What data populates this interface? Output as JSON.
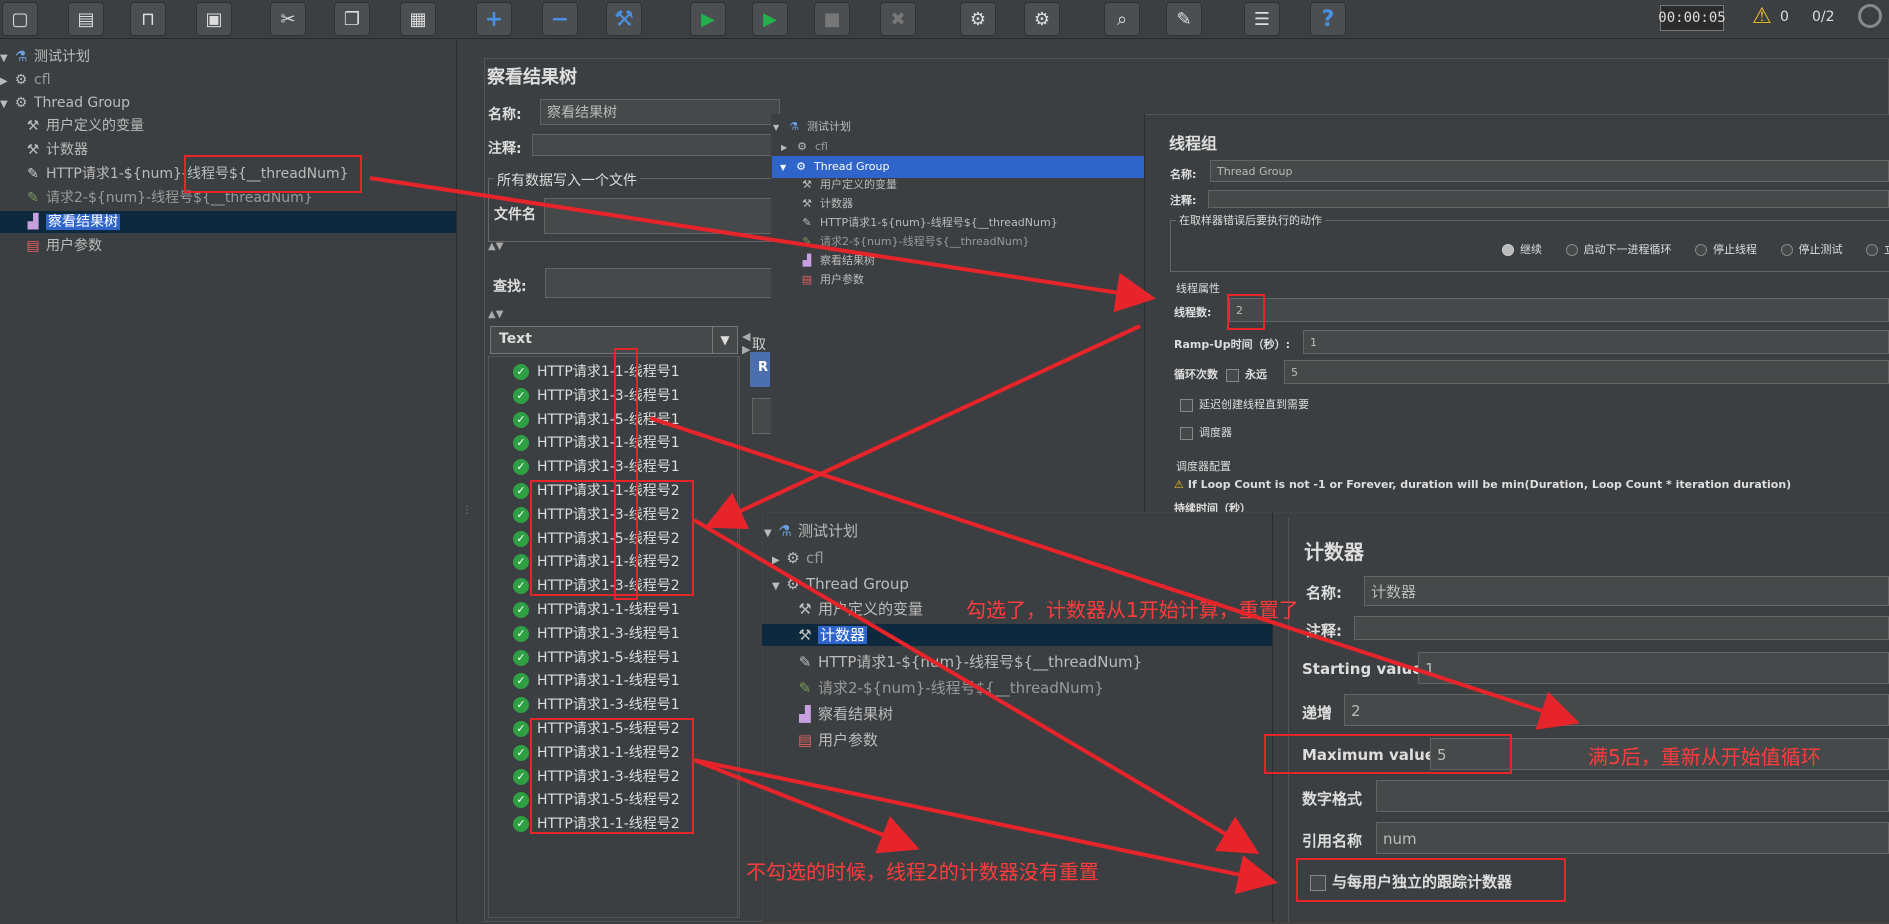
{
  "toolbar": {
    "buttons": [
      {
        "name": "new-icon",
        "glyph": "▢"
      },
      {
        "name": "templates-icon",
        "glyph": "▤"
      },
      {
        "name": "open-icon",
        "glyph": "⊓"
      },
      {
        "name": "save-icon",
        "glyph": "▣"
      },
      {
        "name": "cut-icon",
        "glyph": "✂"
      },
      {
        "name": "copy-icon",
        "glyph": "❐"
      },
      {
        "name": "paste-icon",
        "glyph": "▦"
      },
      {
        "name": "expand-icon",
        "glyph": "+"
      },
      {
        "name": "collapse-icon",
        "glyph": "−"
      },
      {
        "name": "toggle-icon",
        "glyph": "⚒"
      },
      {
        "name": "start-icon",
        "glyph": "▶"
      },
      {
        "name": "start-no-pause-icon",
        "glyph": "▶"
      },
      {
        "name": "stop-icon",
        "glyph": "■"
      },
      {
        "name": "shutdown-icon",
        "glyph": "✖"
      },
      {
        "name": "clear-icon",
        "glyph": "⚙"
      },
      {
        "name": "clear-all-icon",
        "glyph": "⚙"
      },
      {
        "name": "search-icon",
        "glyph": "⌕"
      },
      {
        "name": "reset-search-icon",
        "glyph": "✎"
      },
      {
        "name": "function-helper-icon",
        "glyph": "☰"
      },
      {
        "name": "help-icon",
        "glyph": "?"
      }
    ],
    "timer": "00:00:05",
    "warnings": "0",
    "threads": "0/2"
  },
  "left_tree": {
    "root": "测试计划",
    "cfl": "cfl",
    "thread_group": "Thread Group",
    "user_vars": "用户定义的变量",
    "counter": "计数器",
    "http1": "HTTP请求1-${num}-线程号${__threadNum}",
    "http1_prefix": "HTTP请求1-${num}-",
    "http1_suffix": "线程号${__threadNum}",
    "http2": "请求2-${num}-线程号${__threadNum}",
    "view_tree": "察看结果树",
    "user_params": "用户参数"
  },
  "main": {
    "title": "察看结果树",
    "name_label": "名称:",
    "name_value": "察看结果树",
    "comment_label": "注释:",
    "write_group": "所有数据写入一个文件",
    "filename_label": "文件名",
    "search_label": "查找:",
    "renderer": "Text",
    "tab_partial": "取",
    "results": [
      "HTTP请求1-1-线程号1",
      "HTTP请求1-3-线程号1",
      "HTTP请求1-5-线程号1",
      "HTTP请求1-1-线程号1",
      "HTTP请求1-3-线程号1",
      "HTTP请求1-1-线程号2",
      "HTTP请求1-3-线程号2",
      "HTTP请求1-5-线程号2",
      "HTTP请求1-1-线程号2",
      "HTTP请求1-3-线程号2",
      "HTTP请求1-1-线程号1",
      "HTTP请求1-3-线程号1",
      "HTTP请求1-5-线程号1",
      "HTTP请求1-1-线程号1",
      "HTTP请求1-3-线程号1",
      "HTTP请求1-5-线程号2",
      "HTTP请求1-1-线程号2",
      "HTTP请求1-3-线程号2",
      "HTTP请求1-5-线程号2",
      "HTTP请求1-1-线程号2"
    ]
  },
  "tg_window": {
    "tree": {
      "root": "测试计划",
      "cfl": "cfl",
      "thread_group": "Thread Group",
      "user_vars": "用户定义的变量",
      "counter": "计数器",
      "http1": "HTTP请求1-${num}-线程号${__threadNum}",
      "http2": "请求2-${num}-线程号${__threadNum}",
      "view_tree": "察看结果树",
      "user_params": "用户参数"
    },
    "title": "线程组",
    "name_label": "名称:",
    "name_value": "Thread Group",
    "comment_label": "注释:",
    "error_group": "在取样器错误后要执行的动作",
    "radios": [
      "继续",
      "启动下一进程循环",
      "停止线程",
      "停止测试",
      "立"
    ],
    "props_group": "线程属性",
    "threads_label": "线程数:",
    "threads_value": "2",
    "rampup_label": "Ramp-Up时间（秒）:",
    "rampup_value": "1",
    "loop_label": "循环次数",
    "forever_label": "永远",
    "loop_value": "5",
    "delay_label": "延迟创建线程直到需要",
    "scheduler_label": "调度器",
    "sched_group": "调度器配置",
    "sched_warning": "If Loop Count is not -1 or Forever, duration will be min(Duration, Loop Count * iteration duration)",
    "duration_partial": "持续时间（秒）"
  },
  "counter_window": {
    "tree": {
      "root": "测试计划",
      "cfl": "cfl",
      "thread_group": "Thread Group",
      "user_vars": "用户定义的变量",
      "counter": "计数器",
      "http1": "HTTP请求1-${num}-线程号${__threadNum}",
      "http2": "请求2-${num}-线程号${__threadNum}",
      "view_tree": "察看结果树",
      "user_params": "用户参数"
    },
    "title": "计数器",
    "name_label": "名称:",
    "name_value": "计数器",
    "comment_label": "注释:",
    "start_label": "Starting value",
    "start_value": "1",
    "incr_label": "递增",
    "incr_value": "2",
    "max_label": "Maximum value",
    "max_value": "5",
    "format_label": "数字格式",
    "ref_label": "引用名称",
    "ref_value": "num",
    "per_user_label": "与每用户独立的跟踪计数器"
  },
  "annotations": {
    "checked": "勾选了，计数器从1开始计算，重置了",
    "max_loop": "满5后，重新从开始值循环",
    "unchecked": "不勾选的时候，线程2的计数器没有重置"
  },
  "colors": {
    "accent_red": "#e8242b",
    "selection": "#2f65ca",
    "ok_green": "#2ea043"
  }
}
